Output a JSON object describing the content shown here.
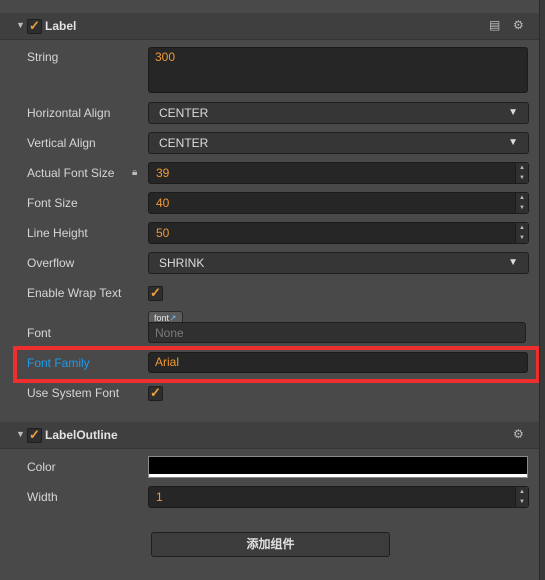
{
  "label_component": {
    "title": "Label",
    "enabled": true,
    "icons": [
      "book-icon",
      "gear-icon"
    ],
    "props": {
      "string_label": "String",
      "string_value": "300",
      "halign_label": "Horizontal Align",
      "halign_value": "CENTER",
      "valign_label": "Vertical Align",
      "valign_value": "CENTER",
      "actual_font_size_label": "Actual Font Size",
      "actual_font_size_value": "39",
      "font_size_label": "Font Size",
      "font_size_value": "40",
      "line_height_label": "Line Height",
      "line_height_value": "50",
      "overflow_label": "Overflow",
      "overflow_value": "SHRINK",
      "wrap_label": "Enable Wrap Text",
      "wrap_checked": true,
      "font_label": "Font",
      "font_tag": "font",
      "font_placeholder": "None",
      "font_family_label": "Font Family",
      "font_family_value": "Arial",
      "system_font_label": "Use System Font",
      "system_font_checked": true
    }
  },
  "outline_component": {
    "title": "LabelOutline",
    "enabled": true,
    "props": {
      "color_label": "Color",
      "color_value": "#000000",
      "width_label": "Width",
      "width_value": "1"
    }
  },
  "add_component_button": "添加组件",
  "highlight_color": "#ef2e2e",
  "value_color": "#f09a37",
  "accent_blue": "#1e9bea"
}
